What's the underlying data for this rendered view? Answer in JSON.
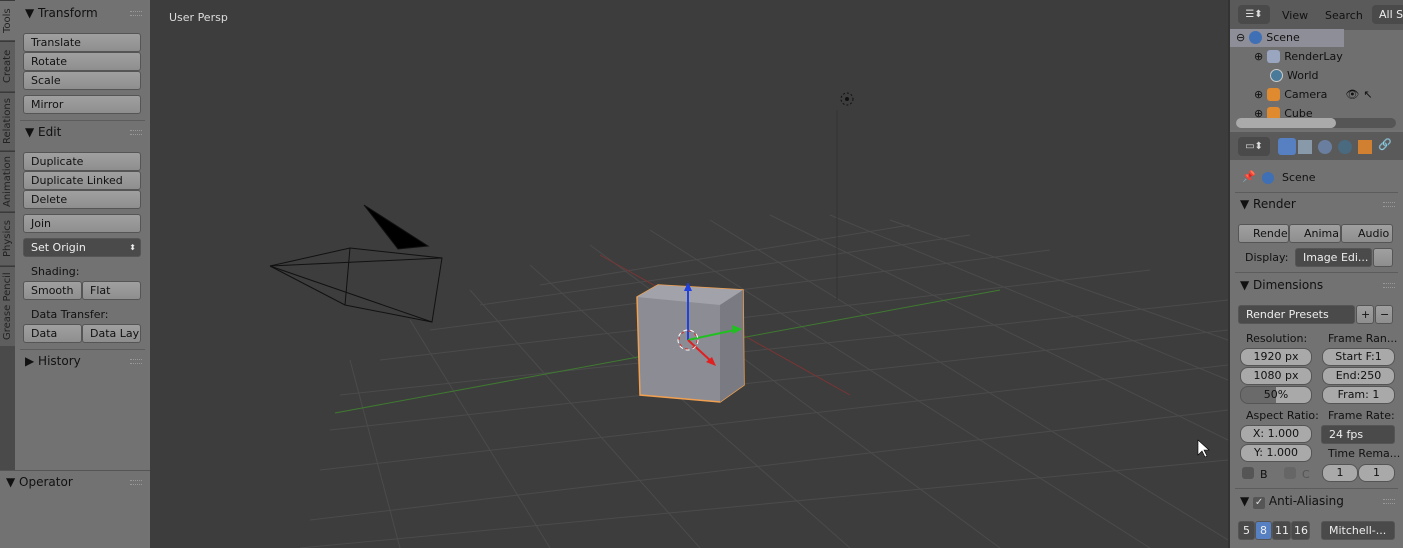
{
  "tabs": [
    "Tools",
    "Create",
    "Relations",
    "Animation",
    "Physics",
    "Grease Pencil"
  ],
  "tool_shelf": {
    "transform": {
      "title": "Transform",
      "buttons": [
        "Translate",
        "Rotate",
        "Scale",
        "Mirror"
      ]
    },
    "edit": {
      "title": "Edit",
      "buttons": [
        "Duplicate",
        "Duplicate Linked",
        "Delete",
        "Join"
      ],
      "set_origin": "Set Origin",
      "shading_label": "Shading:",
      "shading": [
        "Smooth",
        "Flat"
      ],
      "data_transfer_label": "Data Transfer:",
      "data_transfer": [
        "Data",
        "Data Lay"
      ]
    },
    "history": {
      "title": "History"
    },
    "operator": {
      "title": "Operator"
    }
  },
  "viewport": {
    "label": "User Persp"
  },
  "outliner": {
    "menu": [
      "View",
      "Search",
      "All Sc"
    ],
    "items": [
      {
        "label": "Scene",
        "icon": "scene-icon"
      },
      {
        "label": "RenderLay",
        "icon": "render-layer-icon"
      },
      {
        "label": "World",
        "icon": "world-icon"
      },
      {
        "label": "Camera",
        "icon": "camera-icon"
      },
      {
        "label": "Cube",
        "icon": "mesh-icon"
      }
    ]
  },
  "properties": {
    "context": "Scene",
    "render": {
      "title": "Render",
      "buttons": [
        "Rende",
        "Anima",
        "Audio"
      ],
      "display_label": "Display:",
      "display_value": "Image Edi..."
    },
    "dimensions": {
      "title": "Dimensions",
      "presets": "Render Presets",
      "resolution_label": "Resolution:",
      "res_x": "1920 px",
      "res_y": "1080 px",
      "res_pct": "50%",
      "res_pct_value": 50,
      "frame_range_label": "Frame Ran...",
      "start": "Start F:1",
      "end": "End:250",
      "frame": "Fram: 1",
      "aspect_label": "Aspect Ratio:",
      "aspect_x": "X: 1.000",
      "aspect_y": "Y: 1.000",
      "border_b": "B",
      "crop_c": "C",
      "frame_rate_label": "Frame Rate:",
      "fps": "24 fps",
      "time_remap_label": "Time Rema...",
      "remap_old": "1",
      "remap_new": "1"
    },
    "anti_aliasing": {
      "title": "Anti-Aliasing",
      "enabled": true,
      "samples": [
        "5",
        "8",
        "11",
        "16"
      ],
      "selected_sample": "8",
      "filter": "Mitchell-..."
    }
  },
  "colors": {
    "accent": "#5680c2",
    "selection_outline": "#f0a050",
    "axis_x": "#a03030",
    "axis_y": "#4a8a3a"
  }
}
